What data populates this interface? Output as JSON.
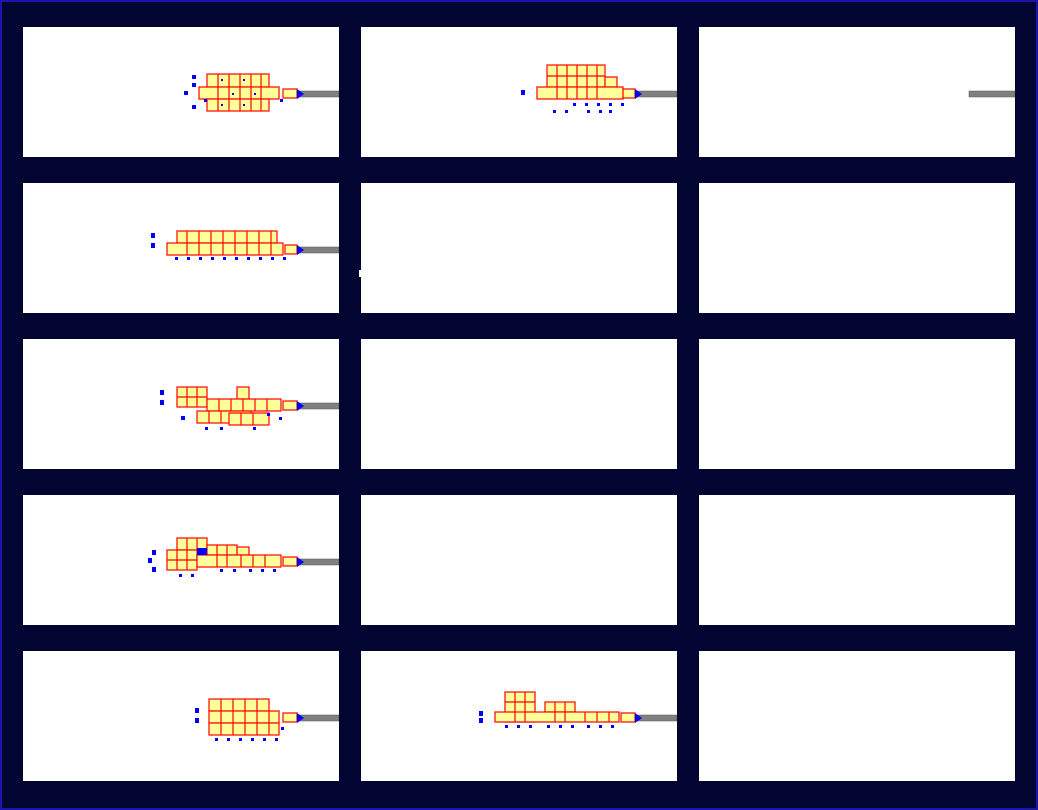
{
  "screen": {
    "background": "#020531",
    "frame_color": "#1a14a8",
    "panel_background": "#ffffff"
  },
  "colors": {
    "room_fill": "#ffff99",
    "room_border": "#ff0000",
    "unit_marker": "#0000ff",
    "corridor": "#808080"
  },
  "panels": [
    {
      "id": "r1c1",
      "row": 1,
      "col": 1,
      "layout": "three-wing",
      "has_base": true,
      "has_corridor": true
    },
    {
      "id": "r1c2",
      "row": 1,
      "col": 2,
      "layout": "tower-block",
      "has_base": true,
      "has_corridor": true
    },
    {
      "id": "r1c3",
      "row": 1,
      "col": 3,
      "layout": "corridor-only",
      "has_base": false,
      "has_corridor": true
    },
    {
      "id": "r2c1",
      "row": 2,
      "col": 1,
      "layout": "long-two-tier",
      "has_base": true,
      "has_corridor": true
    },
    {
      "id": "r2c2",
      "row": 2,
      "col": 2,
      "layout": "empty",
      "has_base": false,
      "has_corridor": false
    },
    {
      "id": "r2c3",
      "row": 2,
      "col": 3,
      "layout": "empty",
      "has_base": false,
      "has_corridor": false
    },
    {
      "id": "r3c1",
      "row": 3,
      "col": 1,
      "layout": "split-complex",
      "has_base": true,
      "has_corridor": true
    },
    {
      "id": "r3c2",
      "row": 3,
      "col": 2,
      "layout": "empty",
      "has_base": false,
      "has_corridor": false
    },
    {
      "id": "r3c3",
      "row": 3,
      "col": 3,
      "layout": "empty",
      "has_base": false,
      "has_corridor": false
    },
    {
      "id": "r4c1",
      "row": 4,
      "col": 1,
      "layout": "stepped-complex",
      "has_base": true,
      "has_corridor": true
    },
    {
      "id": "r4c2",
      "row": 4,
      "col": 2,
      "layout": "empty",
      "has_base": false,
      "has_corridor": false
    },
    {
      "id": "r4c3",
      "row": 4,
      "col": 3,
      "layout": "empty",
      "has_base": false,
      "has_corridor": false
    },
    {
      "id": "r5c1",
      "row": 5,
      "col": 1,
      "layout": "stacked-block",
      "has_base": true,
      "has_corridor": true
    },
    {
      "id": "r5c2",
      "row": 5,
      "col": 2,
      "layout": "wide-complex",
      "has_base": true,
      "has_corridor": true
    },
    {
      "id": "r5c3",
      "row": 5,
      "col": 3,
      "layout": "empty",
      "has_base": false,
      "has_corridor": false
    }
  ]
}
